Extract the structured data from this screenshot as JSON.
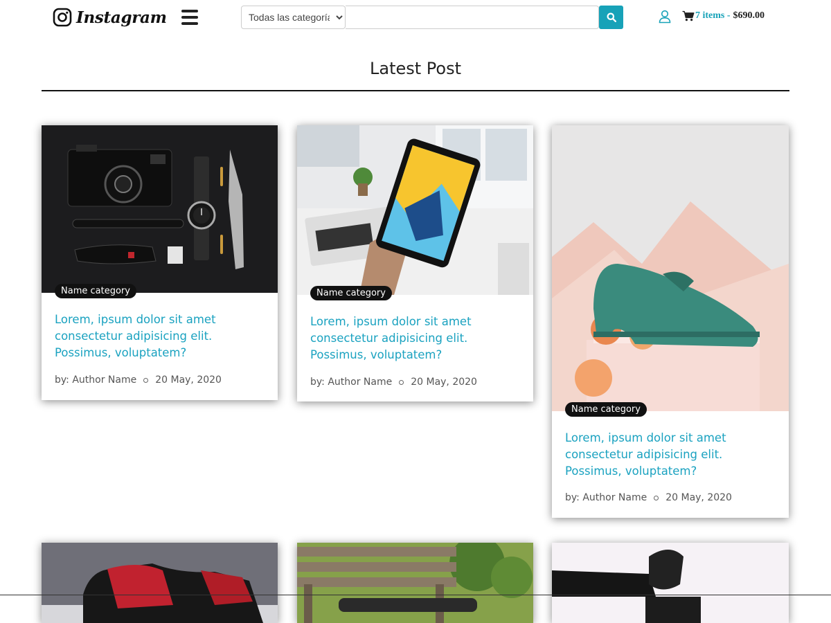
{
  "header": {
    "logo_text": "Instagram",
    "category_select": {
      "selected": "Todas las categorías"
    },
    "search": {
      "value": "",
      "placeholder": ""
    },
    "cart": {
      "items_label": "7 items -",
      "total": "$690.00"
    }
  },
  "section": {
    "title": "Latest Post"
  },
  "posts": [
    {
      "category": "Name category",
      "title": "Lorem, ipsum dolor sit amet consectetur adipisicing elit. Possimus, voluptatem?",
      "author": "by: Author Name",
      "date": "20 May, 2020",
      "image": "camera-flatlay-image"
    },
    {
      "category": "Name category",
      "title": "Lorem, ipsum dolor sit amet consectetur adipisicing elit. Possimus, voluptatem?",
      "author": "by: Author Name",
      "date": "20 May, 2020",
      "image": "tablet-image"
    },
    {
      "category": "Name category",
      "title": "Lorem, ipsum dolor sit amet consectetur adipisicing elit. Possimus, voluptatem?",
      "author": "by: Author Name",
      "date": "20 May, 2020",
      "image": "green-shoe-image"
    }
  ],
  "second_row": [
    {
      "image": "sneaker-image"
    },
    {
      "image": "drone-bench-image"
    },
    {
      "image": "legs-sneakers-image"
    }
  ],
  "colors": {
    "accent": "#17a2b8",
    "title_link": "#1aa2c0",
    "badge_bg": "#111111"
  }
}
